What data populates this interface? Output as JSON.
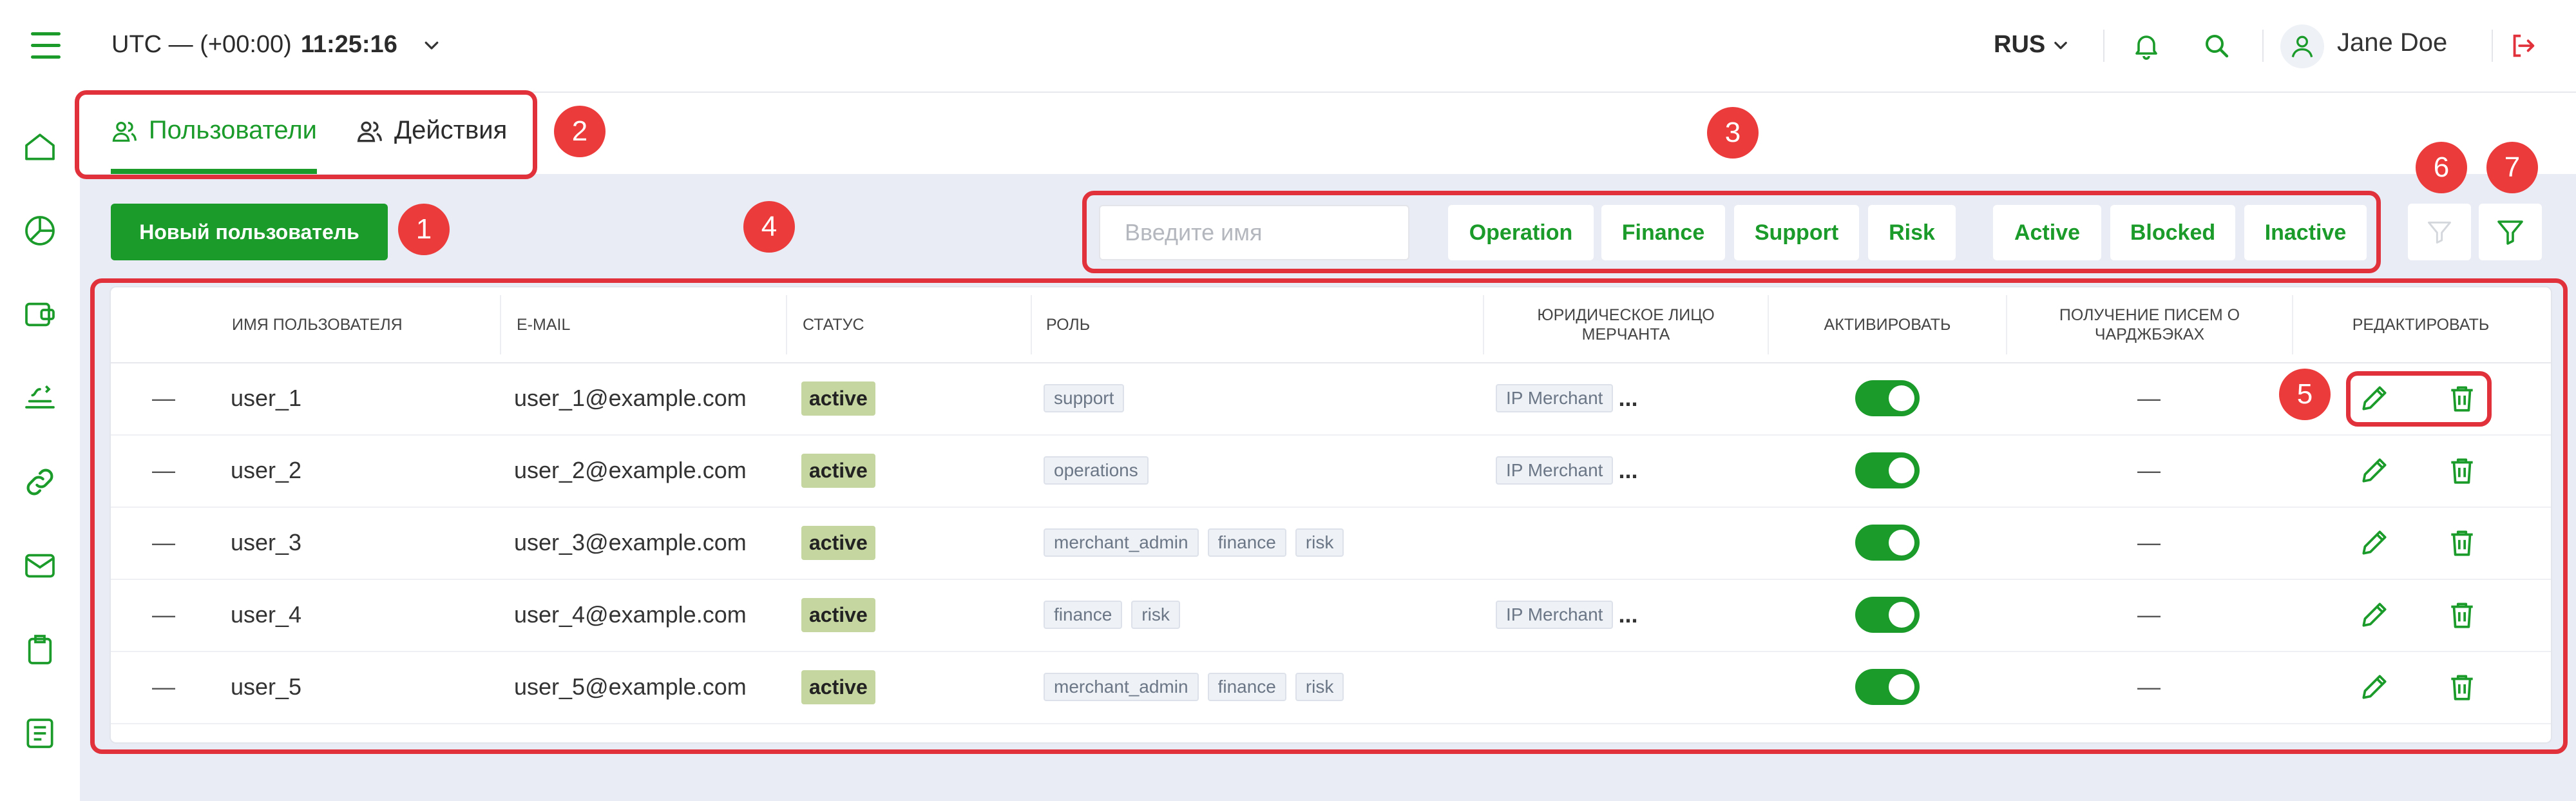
{
  "topbar": {
    "timezone": "UTC — (+00:00)",
    "time": "11:25:16",
    "language": "RUS",
    "user_name": "Jane Doe"
  },
  "tabs": [
    {
      "label": "Пользователи",
      "active": true
    },
    {
      "label": "Действия",
      "active": false
    }
  ],
  "toolbar": {
    "new_user_label": "Новый пользователь",
    "search_placeholder": "Введите имя",
    "role_filters": [
      "Operation",
      "Finance",
      "Support",
      "Risk"
    ],
    "status_filters": [
      "Active",
      "Blocked",
      "Inactive"
    ]
  },
  "table": {
    "headers": {
      "username": "ИМЯ ПОЛЬЗОВАТЕЛЯ",
      "email": "E-MAIL",
      "status": "СТАТУС",
      "role": "РОЛЬ",
      "merchant_line1": "ЮРИДИЧЕСКОЕ ЛИЦО",
      "merchant_line2": "МЕРЧАНТА",
      "activate": "АКТИВИРОВАТЬ",
      "chargeback_line1": "ПОЛУЧЕНИЕ ПИСЕМ О",
      "chargeback_line2": "ЧАРДЖБЭКАХ",
      "edit": "РЕДАКТИРОВАТЬ"
    },
    "rows": [
      {
        "dash": "—",
        "username": "user_1",
        "email": "user_1@example.com",
        "status": "active",
        "roles": [
          "support"
        ],
        "merchant": "IP Merchant",
        "merchant_more": "...",
        "chargeback": "—",
        "active": true
      },
      {
        "dash": "—",
        "username": "user_2",
        "email": "user_2@example.com",
        "status": "active",
        "roles": [
          "operations"
        ],
        "merchant": "IP Merchant",
        "merchant_more": "...",
        "chargeback": "—",
        "active": true
      },
      {
        "dash": "—",
        "username": "user_3",
        "email": "user_3@example.com",
        "status": "active",
        "roles": [
          "merchant_admin",
          "finance",
          "risk"
        ],
        "merchant": "",
        "merchant_more": "",
        "chargeback": "—",
        "active": true
      },
      {
        "dash": "—",
        "username": "user_4",
        "email": "user_4@example.com",
        "status": "active",
        "roles": [
          "finance",
          "risk"
        ],
        "merchant": "IP Merchant",
        "merchant_more": "...",
        "chargeback": "—",
        "active": true
      },
      {
        "dash": "—",
        "username": "user_5",
        "email": "user_5@example.com",
        "status": "active",
        "roles": [
          "merchant_admin",
          "finance",
          "risk"
        ],
        "merchant": "",
        "merchant_more": "",
        "chargeback": "—",
        "active": true
      }
    ]
  },
  "annotations": [
    "1",
    "2",
    "3",
    "4",
    "5",
    "6",
    "7"
  ],
  "colors": {
    "accent": "#1a9b2a",
    "annotation": "#e1323b",
    "status_badge": "#c5d6a0"
  }
}
